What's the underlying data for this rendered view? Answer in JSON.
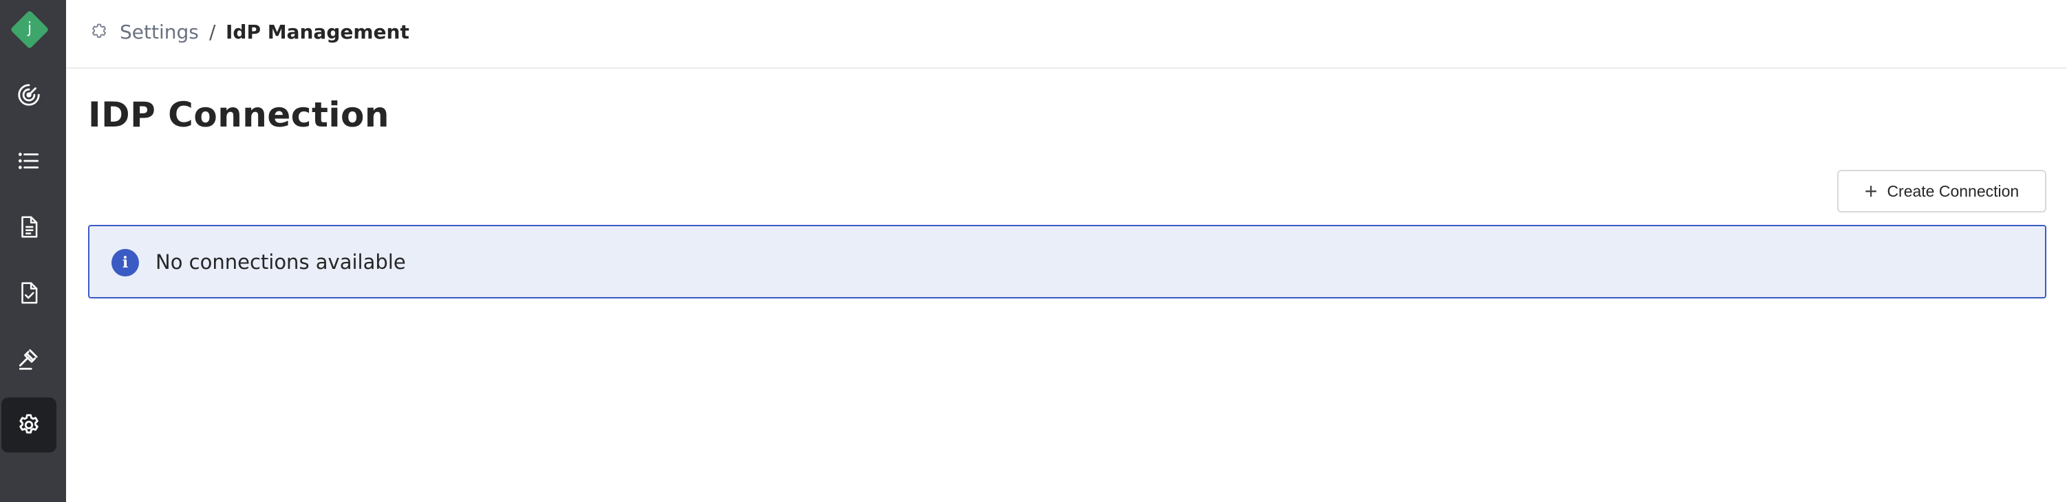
{
  "app": {
    "logo_letter": "j",
    "logo_color": "#3fa66b"
  },
  "sidebar": {
    "items": [
      {
        "name": "radar",
        "icon": "radar-icon",
        "active": false
      },
      {
        "name": "list",
        "icon": "list-icon",
        "active": false
      },
      {
        "name": "documents",
        "icon": "document-icon",
        "active": false
      },
      {
        "name": "approved-documents",
        "icon": "document-check-icon",
        "active": false
      },
      {
        "name": "governance",
        "icon": "gavel-icon",
        "active": false
      },
      {
        "name": "settings",
        "icon": "gear-icon",
        "active": true
      }
    ]
  },
  "breadcrumb": {
    "items": [
      {
        "label": "Settings",
        "icon": "gear-icon"
      },
      {
        "label": "IdP Management"
      }
    ],
    "separator": "/"
  },
  "main": {
    "title": "IDP Connection",
    "create_button": {
      "label": "Create Connection",
      "icon": "plus-icon"
    },
    "info": {
      "message": "No connections available",
      "icon": "info-icon"
    }
  },
  "colors": {
    "sidebar_bg": "#3a3b40",
    "sidebar_active_bg": "#1f2024",
    "info_border": "#3b5bc4",
    "info_bg": "#eaeef9"
  }
}
